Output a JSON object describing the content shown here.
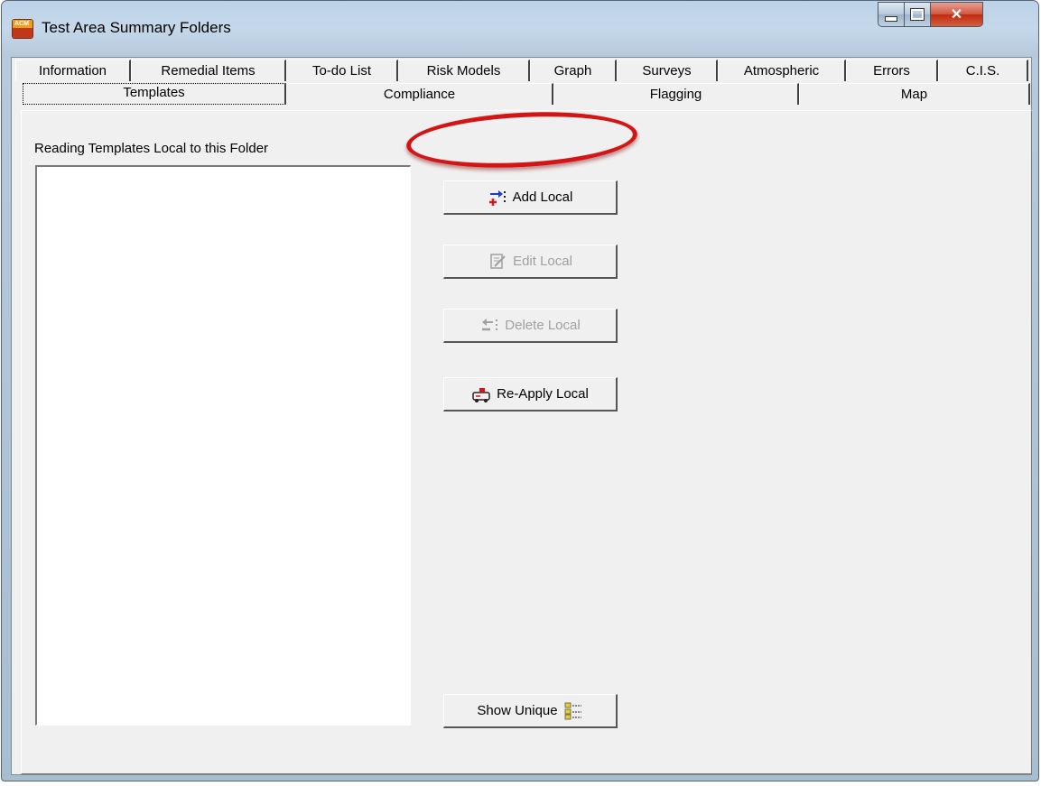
{
  "window": {
    "title": "Test Area Summary Folders",
    "app_icon": "ACM-logo"
  },
  "tabs_row1": [
    {
      "label": "Information"
    },
    {
      "label": "Remedial Items"
    },
    {
      "label": "To-do List"
    },
    {
      "label": "Risk Models"
    },
    {
      "label": "Graph"
    },
    {
      "label": "Surveys"
    },
    {
      "label": "Atmospheric"
    },
    {
      "label": "Errors"
    },
    {
      "label": "C.I.S."
    }
  ],
  "tabs_row2": [
    {
      "label": "Templates",
      "active": true
    },
    {
      "label": "Compliance"
    },
    {
      "label": "Flagging"
    },
    {
      "label": "Map"
    }
  ],
  "templates": {
    "list_label": "Reading Templates Local to this Folder",
    "items": [],
    "buttons": {
      "add_local": {
        "label": "Add Local",
        "icon": "add-template-icon",
        "enabled": true
      },
      "edit_local": {
        "label": "Edit Local",
        "icon": "edit-template-icon",
        "enabled": false
      },
      "delete_local": {
        "label": "Delete Local",
        "icon": "delete-template-icon",
        "enabled": false
      },
      "reapply_local": {
        "label": "Re-Apply Local",
        "icon": "reapply-icon",
        "enabled": true
      },
      "show_unique": {
        "label": "Show Unique",
        "icon": "tree-icon",
        "enabled": true
      }
    }
  },
  "annotation": {
    "color": "#d41515",
    "target": "Add Local"
  }
}
